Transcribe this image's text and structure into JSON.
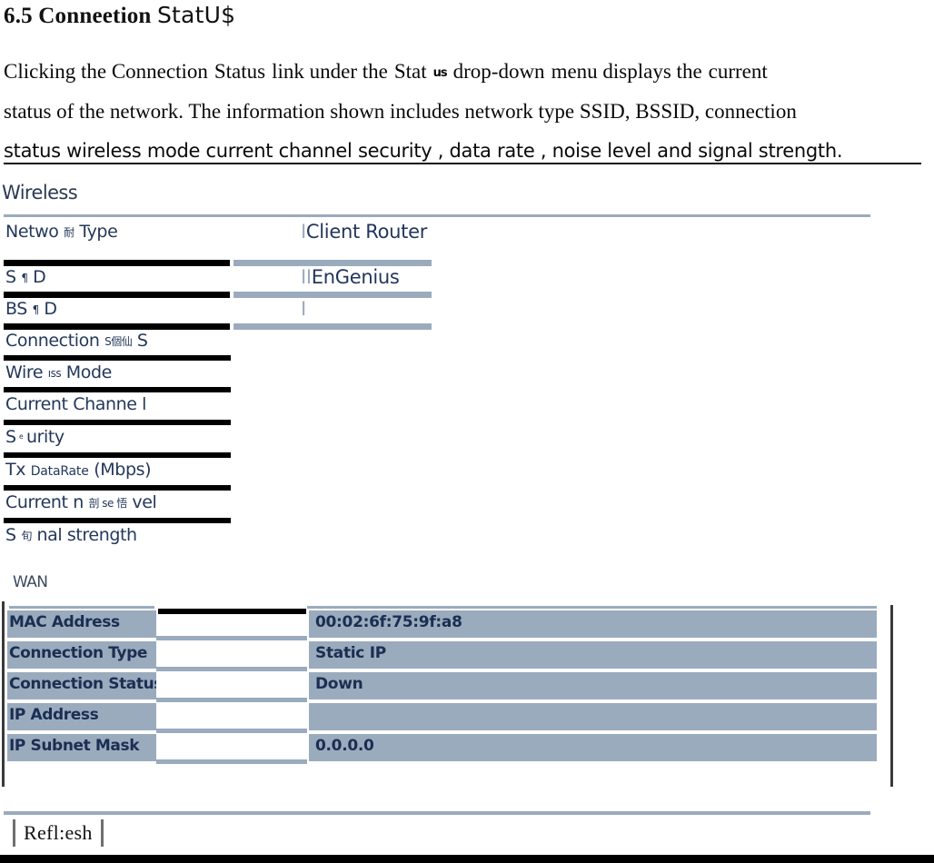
{
  "heading": {
    "number_and_title": "6.5 Conneetion",
    "title_tail": "StatU$"
  },
  "paragraph": {
    "line1_a": "Clicking the Connection",
    "line1_b": "Status",
    "line1_c": "link under the",
    "line1_d": "Stat",
    "line1_garble": "us",
    "line1_e": "drop-down",
    "line1_f": "menu displays the",
    "line1_g": "current",
    "line2": "status  of the  network. The information shown  includes network type   SSID, BSSID, connection",
    "line3": "status   wireless mode   current channel  security , data rate , noise level  and signal strength."
  },
  "sections": {
    "wireless_caption": "Wireless",
    "wan_caption": "WAN"
  },
  "wireless": {
    "rows": [
      {
        "label_main": "Netwo",
        "label_garble": "耐",
        "label_tail": "Type",
        "value_pipes": "I",
        "value": "Client Router"
      },
      {
        "label_main": "S",
        "label_garble": "¶",
        "label_tail": "D",
        "value_pipes": "II",
        "value": "EnGenius"
      },
      {
        "label_main": "BS",
        "label_garble": "¶",
        "label_tail": "D",
        "value_pipes": "I",
        "value": ""
      },
      {
        "label_main": "Connection",
        "label_garble": "S個仙",
        "label_tail": "S",
        "value_pipes": "",
        "value": ""
      },
      {
        "label_main": "Wire",
        "label_garble": "ıss",
        "label_tail": "Mode",
        "value_pipes": "",
        "value": ""
      },
      {
        "label_main": "Current Channe",
        "label_garble": "",
        "label_tail": "l",
        "value_pipes": "",
        "value": ""
      },
      {
        "label_main": "S",
        "label_garble": "ͤ",
        "label_tail": "urity",
        "value_pipes": "",
        "value": ""
      },
      {
        "label_main": "Tx",
        "label_garble": "DataRate",
        "label_tail": "(Mbps)",
        "value_pipes": "",
        "value": ""
      },
      {
        "label_main": "Current n",
        "label_garble": "剖 se 悟",
        "label_tail": "vel",
        "value_pipes": "",
        "value": ""
      },
      {
        "label_main": "S",
        "label_garble": "旬",
        "label_tail": "nal strength",
        "value_pipes": "",
        "value": ""
      }
    ]
  },
  "wan": {
    "rows": [
      {
        "key": "MAC Address",
        "value": "00:02:6f:75:9f:a8"
      },
      {
        "key": "Connection Type",
        "value": "Static IP"
      },
      {
        "key": "Connection Status",
        "value": "Down"
      },
      {
        "key": "IP Address",
        "value": ""
      },
      {
        "key": "IP Subnet Mask",
        "value": "0.0.0.0"
      }
    ]
  },
  "footer": {
    "refresh_label": "Refl:esh"
  },
  "colors": {
    "table_blue": "#9aabbd",
    "text_navy": "#1b2e52",
    "bar_black": "#000000"
  }
}
